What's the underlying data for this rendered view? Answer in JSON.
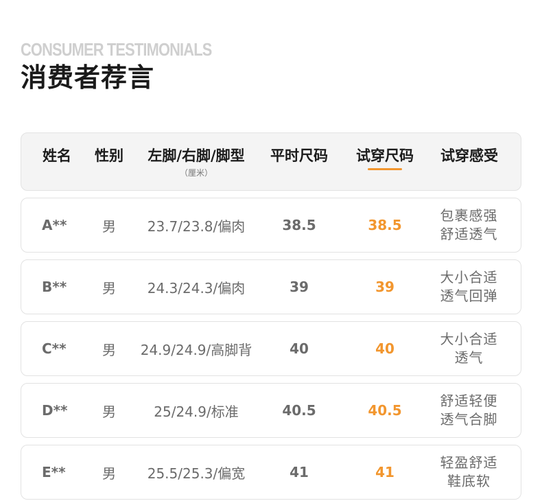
{
  "header": {
    "eyebrow": "CONSUMER TESTIMONIALS",
    "title": "消费者荐言"
  },
  "accent_color": "#f2962e",
  "table": {
    "columns": [
      {
        "label": "姓名",
        "sub": ""
      },
      {
        "label": "性别",
        "sub": ""
      },
      {
        "label": "左脚/右脚/脚型",
        "sub": "（厘米）"
      },
      {
        "label": "平时尺码",
        "sub": ""
      },
      {
        "label": "试穿尺码",
        "sub": ""
      },
      {
        "label": "试穿感受",
        "sub": ""
      }
    ],
    "rows": [
      {
        "name": "A**",
        "sex": "男",
        "foot": "23.7/23.8/偏肉",
        "usual": "38.5",
        "trial": "38.5",
        "feel": [
          "包裹感强",
          "舒适透气"
        ]
      },
      {
        "name": "B**",
        "sex": "男",
        "foot": "24.3/24.3/偏肉",
        "usual": "39",
        "trial": "39",
        "feel": [
          "大小合适",
          "透气回弹"
        ]
      },
      {
        "name": "C**",
        "sex": "男",
        "foot": "24.9/24.9/高脚背",
        "usual": "40",
        "trial": "40",
        "feel": [
          "大小合适",
          "透气"
        ]
      },
      {
        "name": "D**",
        "sex": "男",
        "foot": "25/24.9/标准",
        "usual": "40.5",
        "trial": "40.5",
        "feel": [
          "舒适轻便",
          "透气合脚"
        ]
      },
      {
        "name": "E**",
        "sex": "男",
        "foot": "25.5/25.3/偏宽",
        "usual": "41",
        "trial": "41",
        "feel": [
          "轻盈舒适",
          "鞋底软"
        ]
      }
    ]
  }
}
